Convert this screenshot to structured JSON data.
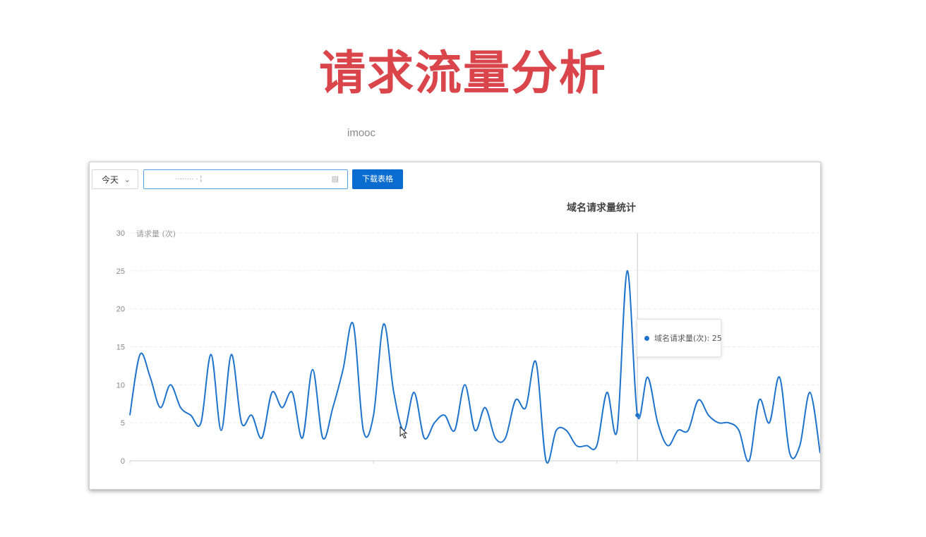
{
  "slide": {
    "title": "请求流量分析",
    "watermark": "imooc"
  },
  "toolbar": {
    "range_select": "今天",
    "date_input_value": "········ · ¦",
    "download_label": "下载表格",
    "chevron_icon": "chevron-down-icon",
    "calendar_icon": "calendar-icon"
  },
  "tooltip": {
    "label": "域名请求量(次)",
    "value": 25
  },
  "colors": {
    "title": "#d9454a",
    "accent": "#0a6ccf",
    "line": "#1e73cc"
  },
  "chart_data": {
    "type": "line",
    "title": "域名请求量统计",
    "ylabel": "请求量 (次)",
    "xlabel": "",
    "ylim": [
      0,
      30
    ],
    "yticks": [
      0,
      5,
      10,
      15,
      20,
      25,
      30
    ],
    "grid": true,
    "highlight_index": 50,
    "series": [
      {
        "name": "域名请求量(次)",
        "values": [
          6,
          14,
          11,
          7,
          10,
          7,
          6,
          5,
          14,
          4,
          14,
          5,
          6,
          3,
          9,
          7,
          9,
          3,
          12,
          3,
          7,
          12,
          18,
          4,
          6,
          18,
          9,
          4,
          9,
          3,
          5,
          6,
          4,
          10,
          4,
          7,
          3,
          3,
          8,
          7,
          13,
          0,
          4,
          4,
          2,
          2,
          2,
          9,
          4,
          25,
          6,
          11,
          5,
          2,
          4,
          4,
          8,
          6,
          5,
          5,
          4,
          0,
          8,
          5,
          11,
          1,
          2,
          9,
          1
        ]
      }
    ]
  }
}
